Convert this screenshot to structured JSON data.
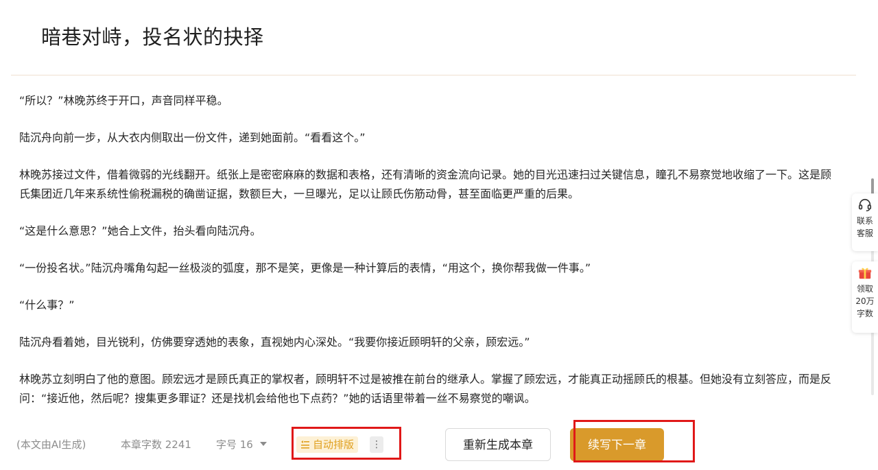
{
  "chapter": {
    "title": "暗巷对峙，投名状的抉择"
  },
  "paragraphs": [
    "“所以？”林晚苏终于开口，声音同样平稳。",
    "陆沉舟向前一步，从大衣内侧取出一份文件，递到她面前。“看看这个。”",
    "林晚苏接过文件，借着微弱的光线翻开。纸张上是密密麻麻的数据和表格，还有清晰的资金流向记录。她的目光迅速扫过关键信息，瞳孔不易察觉地收缩了一下。这是顾氏集团近几年来系统性偷税漏税的确凿证据，数额巨大，一旦曝光，足以让顾氏伤筋动骨，甚至面临更严重的后果。",
    "“这是什么意思？”她合上文件，抬头看向陆沉舟。",
    "“一份投名状。”陆沉舟嘴角勾起一丝极淡的弧度，那不是笑，更像是一种计算后的表情，“用这个，换你帮我做一件事。”",
    "“什么事？”",
    "陆沉舟看着她，目光锐利，仿佛要穿透她的表象，直视她内心深处。“我要你接近顾明轩的父亲，顾宏远。”",
    "林晚苏立刻明白了他的意图。顾宏远才是顾氏真正的掌权者，顾明轩不过是被推在前台的继承人。掌握了顾宏远，才能真正动摇顾氏的根基。但她没有立刻答应，而是反问：“接近他，然后呢？搜集更多罪证？还是找机会给他也下点药？”她的话语里带着一丝不易察觉的嘲讽。"
  ],
  "sidebar": {
    "support_label": "联系\n客服",
    "support_icon": "headset-icon",
    "gift_label": "领取\n20万\n字数",
    "gift_icon": "gift-icon"
  },
  "footer": {
    "ai_note": "(本文由AI生成)",
    "word_count": "本章字数 2241",
    "font_size": "字号 16",
    "auto_layout": "自动排版",
    "auto_layout_icon": "text-align-icon",
    "more": "⋮",
    "regenerate": "重新生成本章",
    "continue_next": "续写下一章"
  },
  "colors": {
    "accent": "#d99a2b",
    "auto_layout_text": "#e0a020",
    "auto_layout_bg": "#fdf1d6",
    "highlight": "#e01818"
  }
}
